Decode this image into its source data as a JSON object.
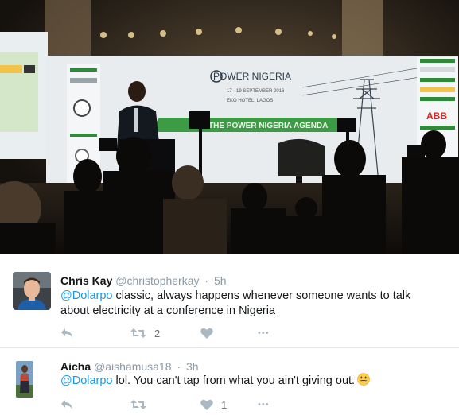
{
  "photo": {
    "alt_banner_title": "POWER NIGERIA",
    "banner_agenda": "THE POWER NIGERIA AGENDA",
    "sponsor_abb": "ABB",
    "colors": {
      "banner_green": "#2f8a3a",
      "backdrop": "#e8ecef",
      "stage": "#171310"
    }
  },
  "tweets": [
    {
      "name": "Chris Kay",
      "handle": "@christopherkay",
      "separator": "·",
      "time": "5h",
      "mention": "@Dolarpo",
      "body": " classic, always happens whenever someone wants to talk about electricity at a conference in Nigeria",
      "retweets": "2",
      "likes": "",
      "more": "•••"
    },
    {
      "name": "Aicha",
      "handle": "@aishamusa18",
      "separator": "·",
      "time": "3h",
      "mention": "@Dolarpo",
      "body": " lol. You can't tap from what you ain't giving out.",
      "retweets": "",
      "likes": "1",
      "more": "•••"
    }
  ],
  "icons": {
    "reply": "reply-icon",
    "retweet": "retweet-icon",
    "like": "heart-icon",
    "more": "more-icon",
    "emoji": "grinning-face-emoji"
  },
  "colors": {
    "link": "#1b95e0",
    "meta": "#8899a6",
    "action": "#aab8c2",
    "divider": "#e1e8ed"
  }
}
